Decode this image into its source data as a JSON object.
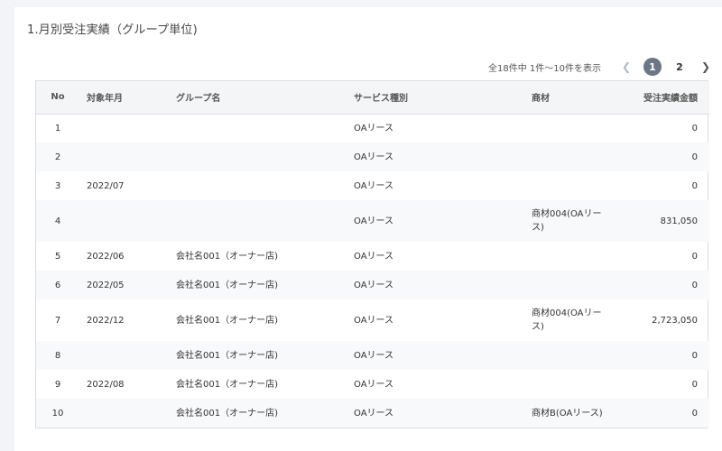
{
  "section": {
    "title": "1.月別受注実績（グループ単位)"
  },
  "pagination": {
    "info": "全18件中 1件〜10件を表示",
    "pages": [
      "1",
      "2"
    ],
    "current": "1",
    "prev_icon": "chevron-left-icon",
    "next_icon": "chevron-right-icon"
  },
  "table": {
    "headers": {
      "no": "No",
      "month": "対象年月",
      "group": "グループ名",
      "service": "サービス種別",
      "item": "商材",
      "amount": "受注実績金額"
    },
    "rows": [
      {
        "no": "1",
        "month": "",
        "group": "",
        "service": "OAリース",
        "item": "",
        "amount": "0"
      },
      {
        "no": "2",
        "month": "",
        "group": "",
        "service": "OAリース",
        "item": "",
        "amount": "0"
      },
      {
        "no": "3",
        "month": "2022/07",
        "group": "",
        "service": "OAリース",
        "item": "",
        "amount": "0"
      },
      {
        "no": "4",
        "month": "",
        "group": "",
        "service": "OAリース",
        "item": "商材004(OAリース)",
        "amount": "831,050"
      },
      {
        "no": "5",
        "month": "2022/06",
        "group": "会社名001（オーナー店)",
        "service": "OAリース",
        "item": "",
        "amount": "0"
      },
      {
        "no": "6",
        "month": "2022/05",
        "group": "会社名001（オーナー店)",
        "service": "OAリース",
        "item": "",
        "amount": "0"
      },
      {
        "no": "7",
        "month": "2022/12",
        "group": "会社名001（オーナー店)",
        "service": "OAリース",
        "item": "商材004(OAリース)",
        "amount": "2,723,050"
      },
      {
        "no": "8",
        "month": "",
        "group": "会社名001（オーナー店)",
        "service": "OAリース",
        "item": "",
        "amount": "0"
      },
      {
        "no": "9",
        "month": "2022/08",
        "group": "会社名001（オーナー店)",
        "service": "OAリース",
        "item": "",
        "amount": "0"
      },
      {
        "no": "10",
        "month": "",
        "group": "会社名001（オーナー店)",
        "service": "OAリース",
        "item": "商材B(OAリース)",
        "amount": "0"
      }
    ]
  }
}
